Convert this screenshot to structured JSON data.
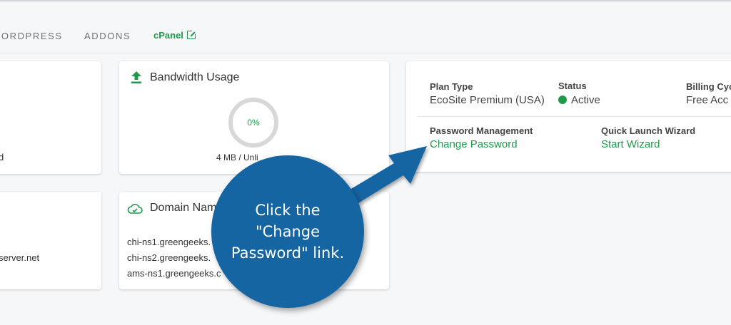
{
  "nav": {
    "items": [
      "WORDPRESS",
      "ADDONS"
    ],
    "cpanel": "cPanel"
  },
  "cards": {
    "left_top_text": "d",
    "left_bottom_text": "server.net",
    "bandwidth": {
      "title": "Bandwidth Usage",
      "percent_label": "0%",
      "usage": "4 MB / Unli",
      "percent": 0
    },
    "domain": {
      "title": "Domain Nam",
      "nameservers": [
        "chi-ns1.greengeeks.",
        "chi-ns2.greengeeks.",
        "ams-ns1.greengeeks.c"
      ]
    },
    "plan": {
      "plan_type_label": "Plan Type",
      "plan_type_value": "EcoSite Premium (USA)",
      "status_label": "Status",
      "status_value": "Active",
      "billing_label": "Billing Cyc",
      "billing_value": "Free Acc",
      "password_label": "Password Management",
      "password_link": "Change Password",
      "wizard_label": "Quick Launch Wizard",
      "wizard_link": "Start Wizard"
    }
  },
  "callout": {
    "lines": [
      "Click the",
      "\"Change",
      "Password\" link."
    ]
  },
  "colors": {
    "accent": "#1f9a4b",
    "callout": "#1565a3"
  }
}
